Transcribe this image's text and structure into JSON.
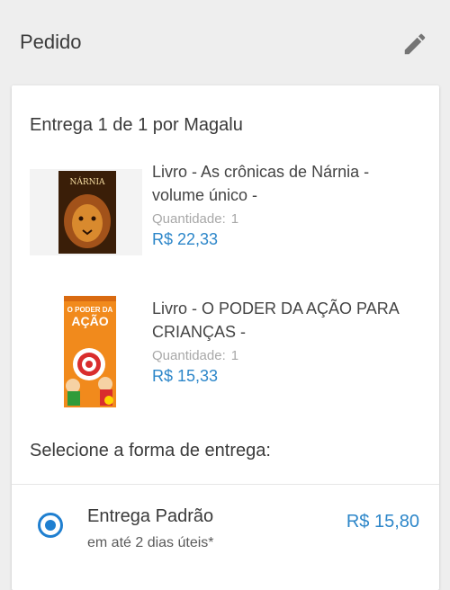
{
  "header": {
    "title": "Pedido",
    "edit_icon": "pencil-icon"
  },
  "delivery": {
    "title": "Entrega 1 de 1 por Magalu",
    "products": [
      {
        "name": "Livro - As crônicas de Nárnia - volume único -",
        "quantity_label": "Quantidade:",
        "quantity": "1",
        "price": "R$ 22,33",
        "cover_text": "NÁRNIA"
      },
      {
        "name": "Livro - O PODER DA AÇÃO PARA CRIANÇAS -",
        "quantity_label": "Quantidade:",
        "quantity": "1",
        "price": "R$ 15,33",
        "cover_text_1": "O PODER DA",
        "cover_text_2": "AÇÃO"
      }
    ],
    "select_title": "Selecione a forma de entrega:",
    "shipping": {
      "name": "Entrega Padrão",
      "time": "em até 2 dias úteis*",
      "price": "R$ 15,80",
      "selected": true
    }
  },
  "colors": {
    "accent": "#1f7fd0",
    "price": "#2c86c9",
    "background": "#eeeeee"
  }
}
